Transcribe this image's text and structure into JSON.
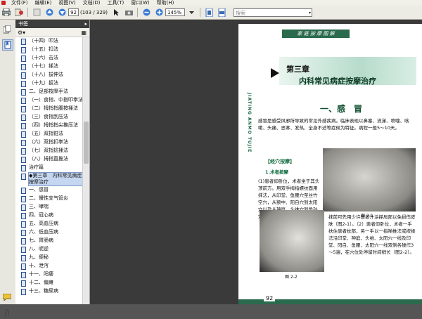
{
  "menubar": {
    "items": [
      "文件(F)",
      "编辑(E)",
      "视图(V)",
      "文档(D)",
      "工具(T)",
      "窗口(W)",
      "帮助(H)"
    ]
  },
  "toolbar": {
    "current_page": "92",
    "page_count": "(103 / 329)",
    "zoom": "145%",
    "search_placeholder": "搜索"
  },
  "bookmarks": {
    "title": "书签",
    "items": [
      "（十四）叩法",
      "（十五）扣法",
      "（十六）击法",
      "（十七）揉法",
      "（十八）拔伸法",
      "（十九）扳法",
      "二、足部按摩手法",
      "（一）食指、中指叩拳法",
      "（二）拇指指腹按揉法",
      "（三）食指刮压法",
      "（四）拇指指尖推压法",
      "（五）双指钳法",
      "（六）双指扣拳法",
      "（七）双指捻揉法",
      "（八）拇指直推法",
      "治疗篇",
      "◆第三章　内科常见病症按摩治疗",
      "一、感冒",
      "二、慢性支气管炎",
      "三、哮喘",
      "四、冠心病",
      "五、高血压病",
      "六、低血压病",
      "七、胃肠病",
      "八、呃逆",
      "九、便秘",
      "十、泄泻",
      "十一、阳痿",
      "十二、偏瘫",
      "十三、糖尿病"
    ],
    "selected_index": 16
  },
  "page": {
    "running_head": "家 庭 按 摩 图 解",
    "vertical_title": "JIATING ANMO TUJIE",
    "chapter_number": "第三章",
    "chapter_title": "内科常见病症按摩治疗",
    "section_title": "一、感　冒",
    "body_text": "感冒是感受风邪所导致的常见外感疾病。临床表现以鼻塞、流涕、喷嚏、咳嗽、头痛、恶寒、发热、全身不适等症候为特征。病程一般5～10天。",
    "tag": "【经穴按摩】",
    "method_title": "1.术者按摩",
    "method_text_1": "(1)患者仰卧位，术者坐于其头顶前方。用双手拇指螺纹面用抹法，从印堂、鱼腰穴至丝竹空穴，从额中、阳白穴到太阳穴以及从神庭、头维穴到角孙穴三线各操作3～5遍。",
    "figure_1_caption": "图 2-1",
    "figure_2_caption": "图 2-2",
    "method_text_2": "抹前可先用少许葱姜汁涂搽局部以免损伤皮肤（图2-1）。（2）患者仰卧位，术者一手扶住患者枕部，另一手以一指禅推法或按揉法沿印堂、神庭、头维、太阳穴一线及印堂、阳白、鱼腰、太阳穴一线双侧各操作3～5遍，在穴位处停留时间稍长（图2-2）。",
    "page_number": "92"
  }
}
